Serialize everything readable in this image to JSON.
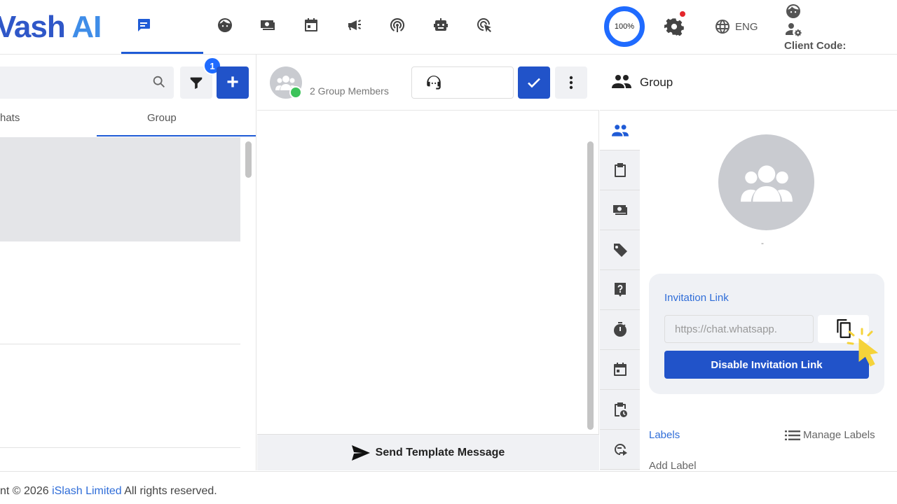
{
  "app": {
    "logo_part1": "Vash",
    "logo_part2": "AI",
    "progress_label": "100%",
    "language": "ENG",
    "client_code_label": "Client Code:"
  },
  "nav_icons": [
    "chat-icon",
    "face-icon",
    "money-icon",
    "calendar-icon",
    "megaphone-icon",
    "broadcast-icon",
    "robot-icon",
    "cursor-click-icon"
  ],
  "left_panel": {
    "filter_badge": "1",
    "tabs": [
      {
        "label": "hats"
      },
      {
        "label": "Group"
      }
    ]
  },
  "chat": {
    "members_label": "2 Group Members",
    "send_template_label": "Send Template Message"
  },
  "right_panel": {
    "title": "Group",
    "avatar_caption": "-",
    "invitation": {
      "label": "Invitation Link",
      "link_value": "https://chat.whatsapp.",
      "disable_label": "Disable Invitation Link"
    },
    "labels": {
      "title": "Labels",
      "manage": "Manage Labels",
      "add": "Add Label"
    }
  },
  "footer": {
    "prefix": "nt © 2026",
    "company": "iSlash Limited",
    "suffix": "All rights reserved."
  },
  "colors": {
    "primary": "#2153c9",
    "accent": "#1f6bff",
    "link": "#2f6dd8",
    "panel_bg": "#f0f1f4"
  }
}
